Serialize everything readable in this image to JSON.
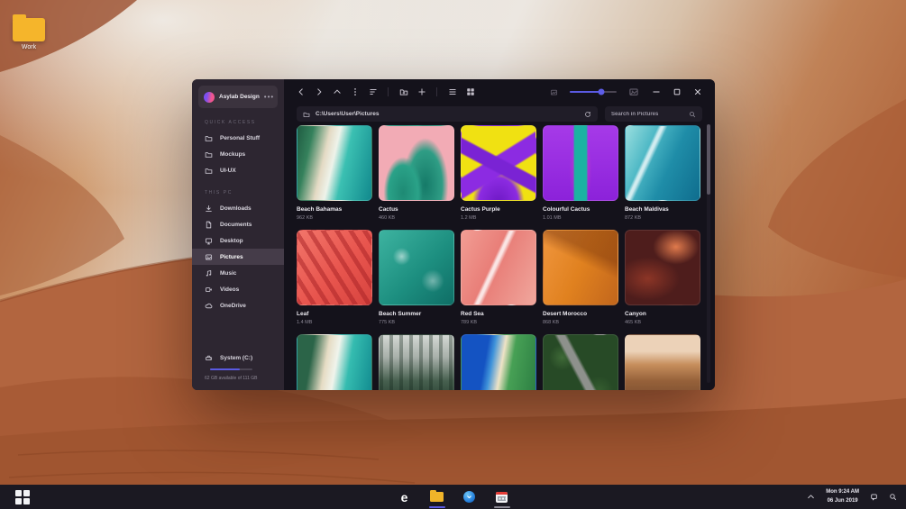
{
  "colors": {
    "accent": "#5a5ae2",
    "folder_yellow": "#f5b52b",
    "window_bg": "#14121b",
    "sidebar_bg": "#2d2631",
    "taskbar_bg": "#1b1922"
  },
  "desktop": {
    "work_folder_label": "Work"
  },
  "window": {
    "profile": {
      "name": "Asylab Design",
      "menu_icon": "more-horizontal"
    },
    "sidebar": {
      "quick_access_label": "QUICK ACCESS",
      "quick_access": [
        {
          "label": "Personal Stuff",
          "icon": "folder"
        },
        {
          "label": "Mockups",
          "icon": "folder"
        },
        {
          "label": "UI-UX",
          "icon": "folder"
        }
      ],
      "this_pc_label": "THIS PC",
      "this_pc": [
        {
          "label": "Downloads",
          "icon": "download"
        },
        {
          "label": "Documents",
          "icon": "document"
        },
        {
          "label": "Desktop",
          "icon": "desktop"
        },
        {
          "label": "Pictures",
          "icon": "picture",
          "selected": true
        },
        {
          "label": "Music",
          "icon": "music"
        },
        {
          "label": "Videos",
          "icon": "video"
        },
        {
          "label": "OneDrive",
          "icon": "cloud"
        }
      ],
      "system_drive": {
        "label": "System (C:)",
        "icon": "drive",
        "available": "62 GB available of 111 GB",
        "fill_percent": 70
      }
    },
    "toolbar": {
      "left_icons": [
        "back",
        "forward",
        "up",
        "more-vertical",
        "sort",
        "sep",
        "new-folder",
        "add",
        "sep",
        "list-view",
        "grid-view"
      ],
      "disabled_icons": [
        "forward"
      ],
      "active_icons": [
        "grid-view"
      ],
      "zoom_slider": {
        "value_percent": 67,
        "small_icon": "image-small",
        "large_icon": "image-large"
      },
      "window_controls": [
        "minimize",
        "maximize",
        "close"
      ]
    },
    "addressbar": {
      "path": "C:\\Users\\User\\Pictures",
      "folder_icon": "folder",
      "refresh_icon": "refresh"
    },
    "search": {
      "placeholder": "Search in Pictures",
      "icon": "search"
    },
    "files": [
      {
        "name": "Beach Bahamas",
        "size": "962 KB",
        "thumb": "beach-bahamas"
      },
      {
        "name": "Cactus",
        "size": "460 KB",
        "thumb": "cactus"
      },
      {
        "name": "Cactus Purple",
        "size": "1.2 MB",
        "thumb": "cactus-purple"
      },
      {
        "name": "Colourful Cactus",
        "size": "1.01 MB",
        "thumb": "colourful-cactus"
      },
      {
        "name": "Beach Maldivas",
        "size": "872 KB",
        "thumb": "beach-maldivas"
      },
      {
        "name": "Leaf",
        "size": "1.4 MB",
        "thumb": "leaf"
      },
      {
        "name": "Beach Summer",
        "size": "775 KB",
        "thumb": "beach-summer"
      },
      {
        "name": "Red Sea",
        "size": "789 KB",
        "thumb": "red-sea"
      },
      {
        "name": "Desert Morocco",
        "size": "868 KB",
        "thumb": "desert-morocco"
      },
      {
        "name": "Canyon",
        "size": "465 KB",
        "thumb": "canyon"
      },
      {
        "name": "",
        "size": "",
        "thumb": "beach-aerial"
      },
      {
        "name": "",
        "size": "",
        "thumb": "foggy-forest"
      },
      {
        "name": "",
        "size": "",
        "thumb": "beach-cove"
      },
      {
        "name": "",
        "size": "",
        "thumb": "forest-road"
      },
      {
        "name": "",
        "size": "",
        "thumb": "mountain"
      }
    ]
  },
  "taskbar": {
    "start_icon": "start",
    "apps": [
      {
        "icon": "edge"
      },
      {
        "icon": "explorer-folder",
        "underline": "accent"
      },
      {
        "icon": "defender"
      },
      {
        "icon": "calendar",
        "underline": "muted"
      }
    ],
    "tray_icons": [
      "chevron-up",
      "notification",
      "search"
    ],
    "clock": {
      "time": "Mon 9:24 AM",
      "date": "06 Jun 2019"
    }
  }
}
